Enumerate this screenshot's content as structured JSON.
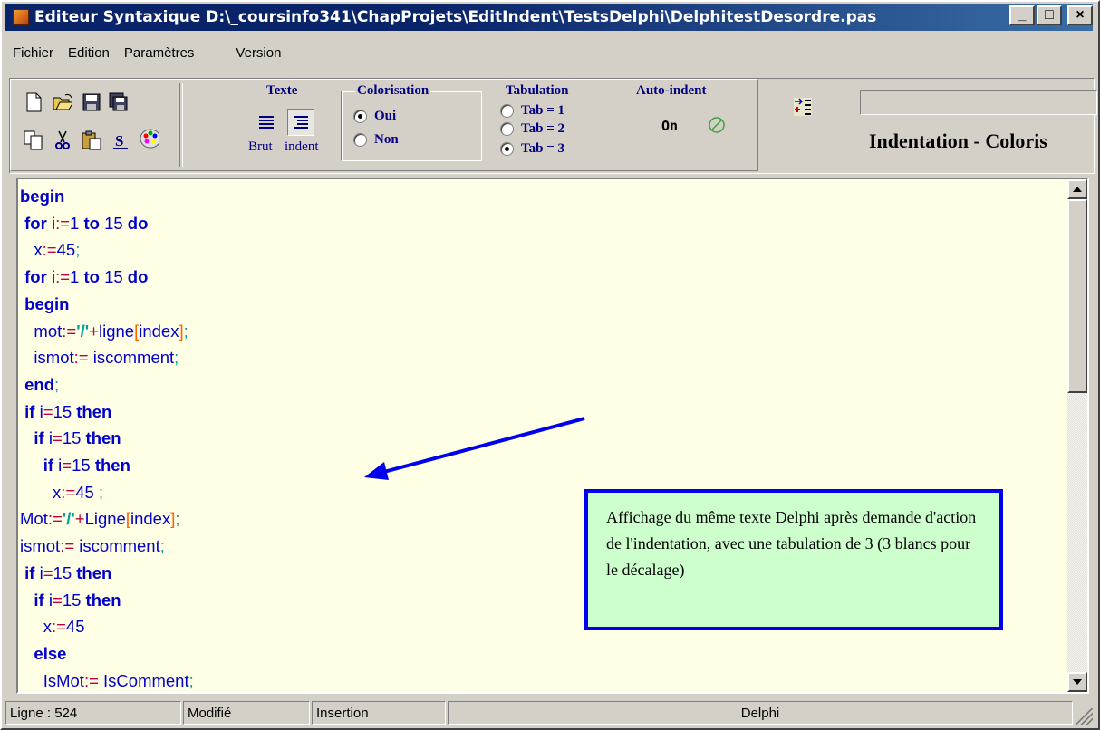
{
  "window": {
    "title": "Editeur Syntaxique D:\\_coursinfo341\\ChapProjets\\EditIndent\\TestsDelphi\\DelphitestDesordre.pas",
    "buttons": {
      "minimize": "_",
      "maximize": "□",
      "close": "×"
    }
  },
  "menu": {
    "items": [
      "Fichier",
      "Edition",
      "Paramètres",
      "Version"
    ]
  },
  "toolbar": {
    "file_icons": [
      "new-file-icon",
      "open-folder-icon",
      "save-icon",
      "save-all-icon"
    ],
    "edit_icons": [
      "copy-icon",
      "cut-icon",
      "paste-icon",
      "strikethrough-s-icon",
      "palette-icon"
    ],
    "texte": {
      "label": "Texte",
      "brut": "Brut",
      "indent": "indent"
    },
    "colorisation": {
      "label": "Colorisation",
      "oui": "Oui",
      "non": "Non",
      "selected": "Oui"
    },
    "tabulation": {
      "label": "Tabulation",
      "options": [
        "Tab = 1",
        "Tab = 2",
        "Tab = 3"
      ],
      "selected": "Tab = 3"
    },
    "autoindent": {
      "label": "Auto-indent",
      "state": "On"
    },
    "right_title": "Indentation - Coloris"
  },
  "editor": {
    "callout": "Affichage du même texte Delphi après demande d'action de l'indentation, avec une tabulation de 3 (3 blancs pour le décalage)"
  },
  "statusbar": {
    "line": "Ligne : 524",
    "modified": "Modifié",
    "mode": "Insertion",
    "language": "Delphi"
  },
  "colors": {
    "title_bar": "#0a246a",
    "editor_bg": "#ffffe6",
    "callout_bg": "#ccffcc",
    "callout_border": "#0000ee",
    "keyword": "#0000c8"
  }
}
